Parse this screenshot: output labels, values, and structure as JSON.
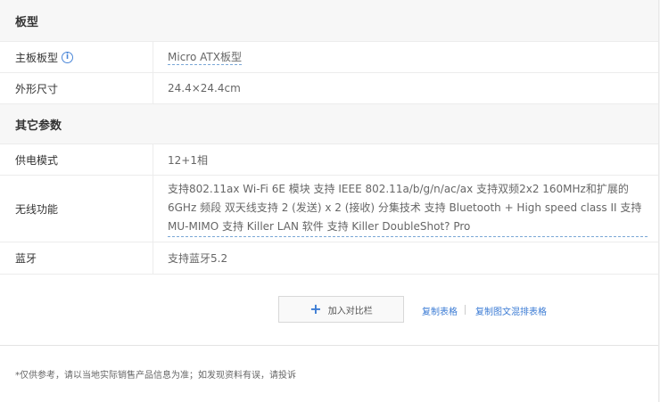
{
  "sections": [
    {
      "title": "板型"
    },
    {
      "title": "其它参数"
    }
  ],
  "rows": {
    "board_type": {
      "key": "主板板型",
      "value": "Micro ATX板型"
    },
    "form_size": {
      "key": "外形尺寸",
      "value": "24.4×24.4cm"
    },
    "power_mode": {
      "key": "供电模式",
      "value": "12+1相"
    },
    "wireless": {
      "key": "无线功能",
      "value": "支持802.11ax Wi-Fi 6E 模块 支持 IEEE 802.11a/b/g/n/ac/ax 支持双频2x2 160MHz和扩展的6GHz 频段 双天线支持 2 (发送) x 2 (接收) 分集技术 支持 Bluetooth + High speed class II 支持 MU-MIMO 支持 Killer LAN 软件 支持 Killer DoubleShot? Pro"
    },
    "bluetooth": {
      "key": "蓝牙",
      "value": "支持蓝牙5.2"
    }
  },
  "actions": {
    "add_compare": "加入对比栏",
    "copy_table": "复制表格",
    "copy_table_with_images": "复制图文混排表格"
  },
  "footer": "*仅供参考，请以当地实际销售产品信息为准；如发现资料有误，请投诉"
}
